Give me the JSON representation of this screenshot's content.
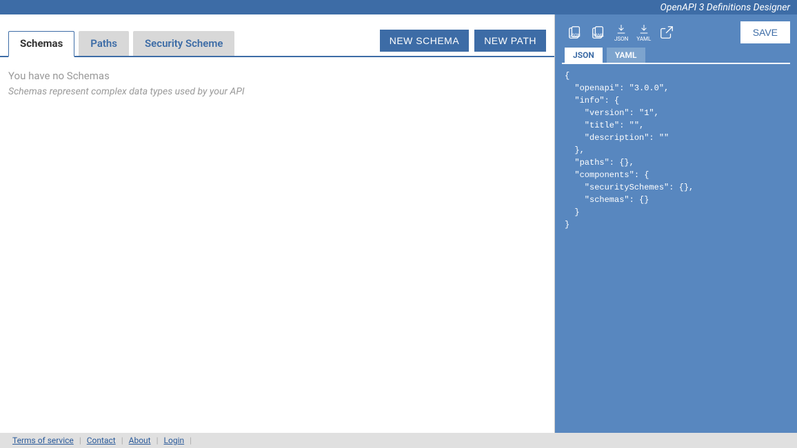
{
  "header": {
    "title": "OpenAPI 3 Definitions Designer"
  },
  "leftPanel": {
    "tabs": [
      {
        "label": "Schemas",
        "active": true
      },
      {
        "label": "Paths",
        "active": false
      },
      {
        "label": "Security Scheme",
        "active": false
      }
    ],
    "buttons": {
      "newSchema": "NEW SCHEMA",
      "newPath": "NEW PATH"
    },
    "empty": {
      "heading": "You have no Schemas",
      "sub": "Schemas represent complex data types used by your API"
    }
  },
  "rightPanel": {
    "toolbar": {
      "copyJsonBadge": "JSON",
      "copyYamlBadge": "YAML",
      "downloadJsonLabel": "JSON",
      "downloadYamlLabel": "YAML",
      "save": "SAVE"
    },
    "formatTabs": [
      {
        "label": "JSON",
        "active": true
      },
      {
        "label": "YAML",
        "active": false
      }
    ],
    "code": "{\n  \"openapi\": \"3.0.0\",\n  \"info\": {\n    \"version\": \"1\",\n    \"title\": \"\",\n    \"description\": \"\"\n  },\n  \"paths\": {},\n  \"components\": {\n    \"securitySchemes\": {},\n    \"schemas\": {}\n  }\n}"
  },
  "footer": {
    "links": [
      "Terms of service",
      "Contact",
      "About",
      "Login"
    ]
  }
}
